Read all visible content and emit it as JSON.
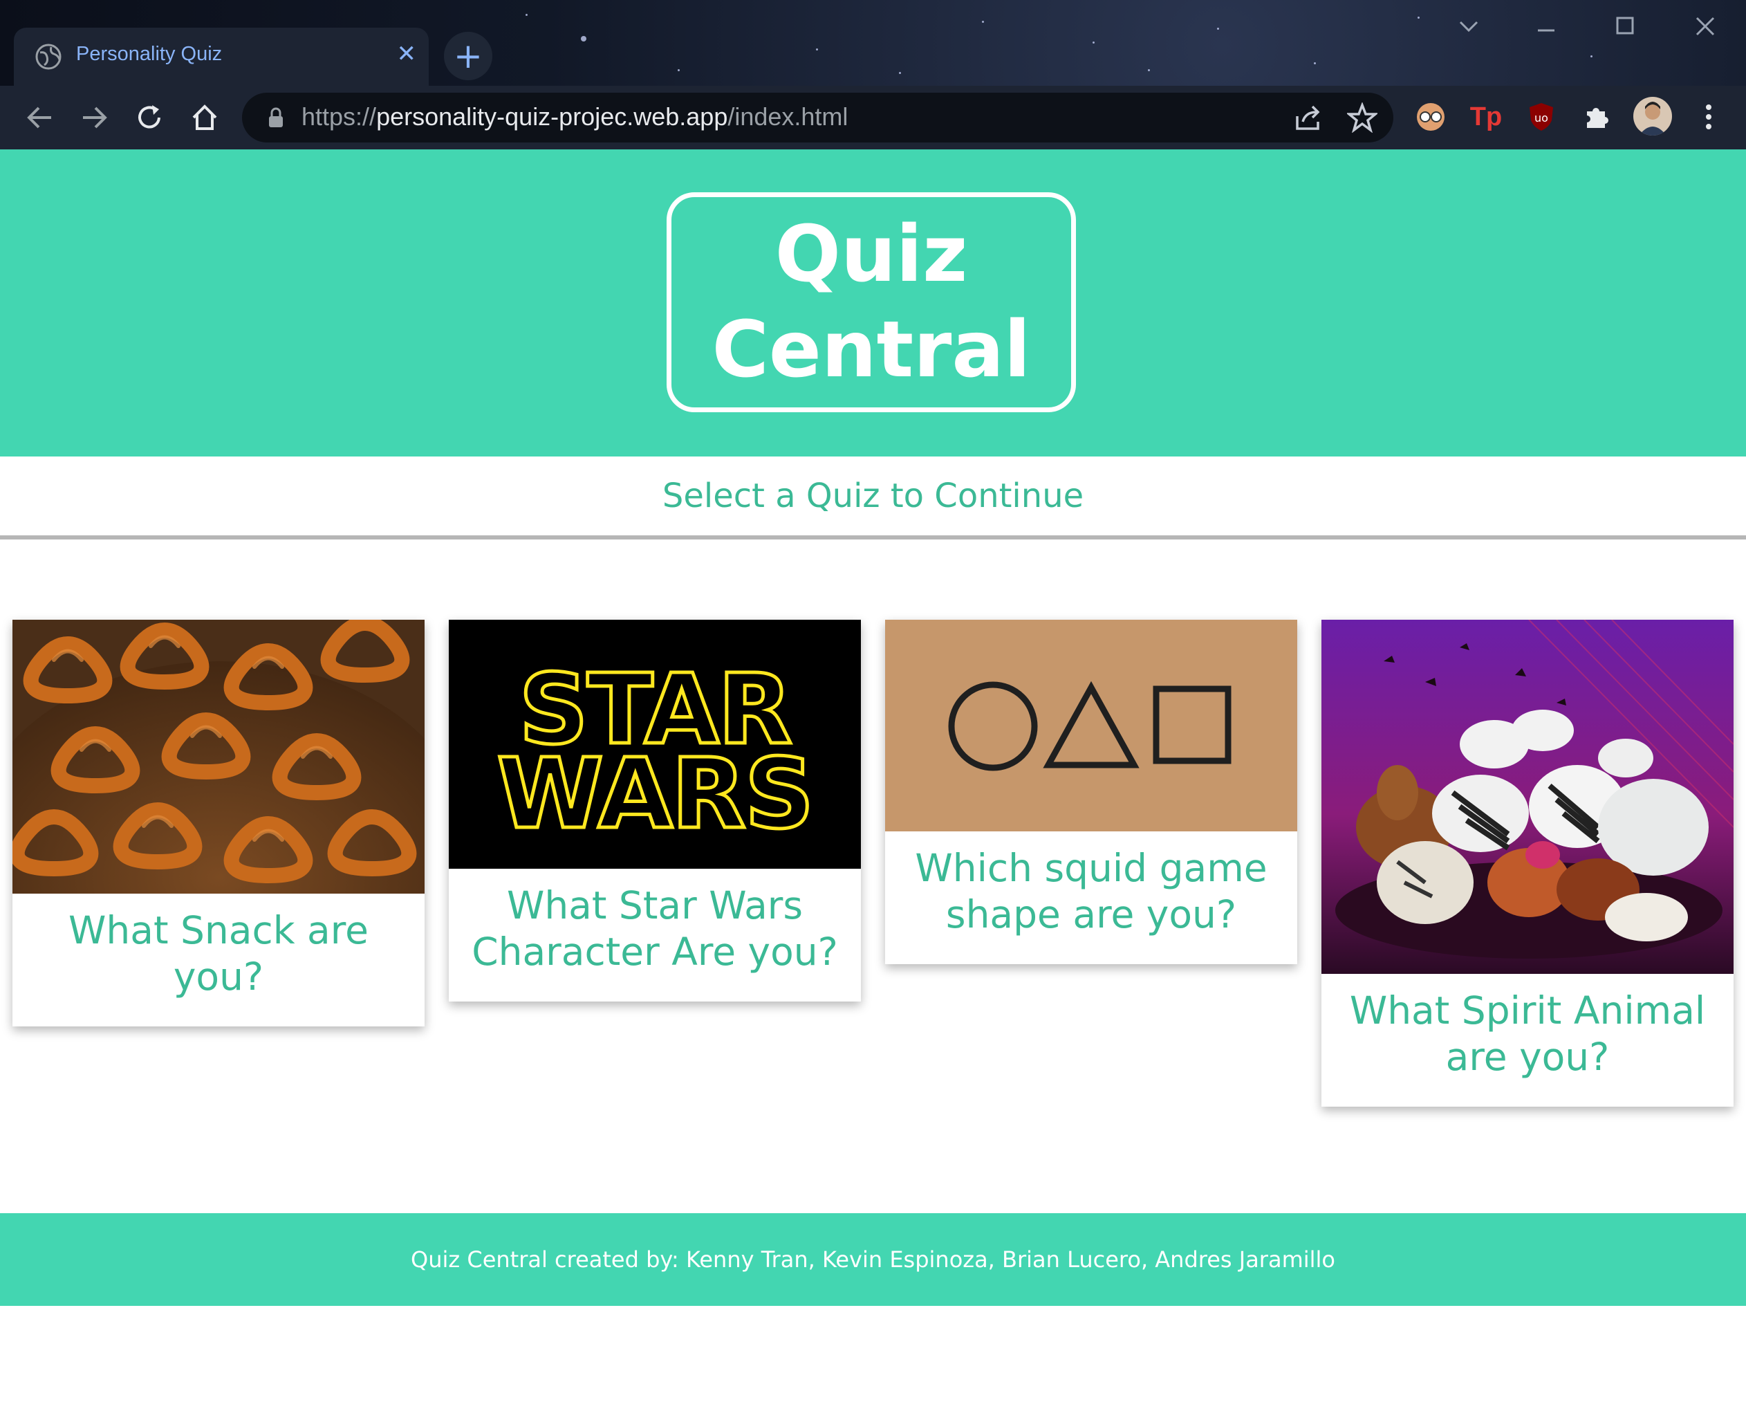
{
  "browser": {
    "tab_title": "Personality Quiz",
    "tab_close_symbol": "✕",
    "new_tab_symbol": "+",
    "url_scheme": "https://",
    "url_host": "personality-quiz-projec.web.app",
    "url_path": "/index.html",
    "icons": {
      "back": "back-arrow-icon",
      "forward": "forward-arrow-icon",
      "reload": "reload-icon",
      "home": "home-icon",
      "lock": "lock-icon",
      "share": "share-icon",
      "bookmark": "star-icon",
      "extensions": "puzzle-icon",
      "menu": "kebab-menu-icon"
    },
    "extension_badges": {
      "tp": "Tp",
      "ublock": "uo"
    }
  },
  "header": {
    "logo_line1": "Quiz",
    "logo_line2": "Central"
  },
  "subtitle": "Select a Quiz to Continue",
  "quizzes": [
    {
      "title": "What Snack are you?",
      "image": "pretzels-image"
    },
    {
      "title": "What Star Wars Character Are you?",
      "image": "star-wars-logo-image",
      "logo_line1": "STAR",
      "logo_line2": "WARS"
    },
    {
      "title": "Which squid game shape are you?",
      "image": "squid-game-shapes-image"
    },
    {
      "title": "What Spirit Animal are you?",
      "image": "animals-group-image"
    }
  ],
  "footer": "Quiz Central created by: Kenny Tran, Kevin Espinoza, Brian Lucero, Andres Jaramillo",
  "colors": {
    "accent": "#43d6b1",
    "accent_text": "#3bb995",
    "white": "#ffffff"
  }
}
